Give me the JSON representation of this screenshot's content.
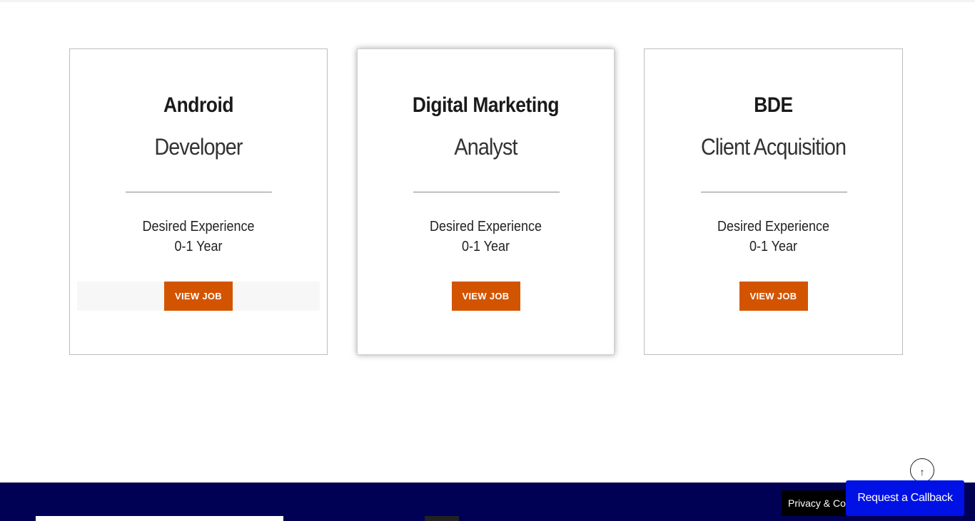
{
  "jobs": [
    {
      "title": "Android",
      "subtitle": "Developer",
      "experience_label": "Desired Experience",
      "experience_value": "0-1 Year",
      "button_label": "VIEW JOB"
    },
    {
      "title": "Digital Marketing",
      "subtitle": "Analyst",
      "experience_label": "Desired Experience",
      "experience_value": "0-1 Year",
      "button_label": "VIEW JOB"
    },
    {
      "title": "BDE",
      "subtitle": "Client Acquisition",
      "experience_label": "Desired Experience",
      "experience_value": "0-1 Year",
      "button_label": "VIEW JOB"
    }
  ],
  "footer": {
    "cookie_text": "Privacy & Coo",
    "callback_label": "Request a Callback",
    "scroll_top_icon": "arrow-up-icon",
    "scroll_top_glyph": "↑",
    "background_color": "#000055"
  },
  "colors": {
    "button": "#d35400",
    "callback": "#0011e6"
  }
}
